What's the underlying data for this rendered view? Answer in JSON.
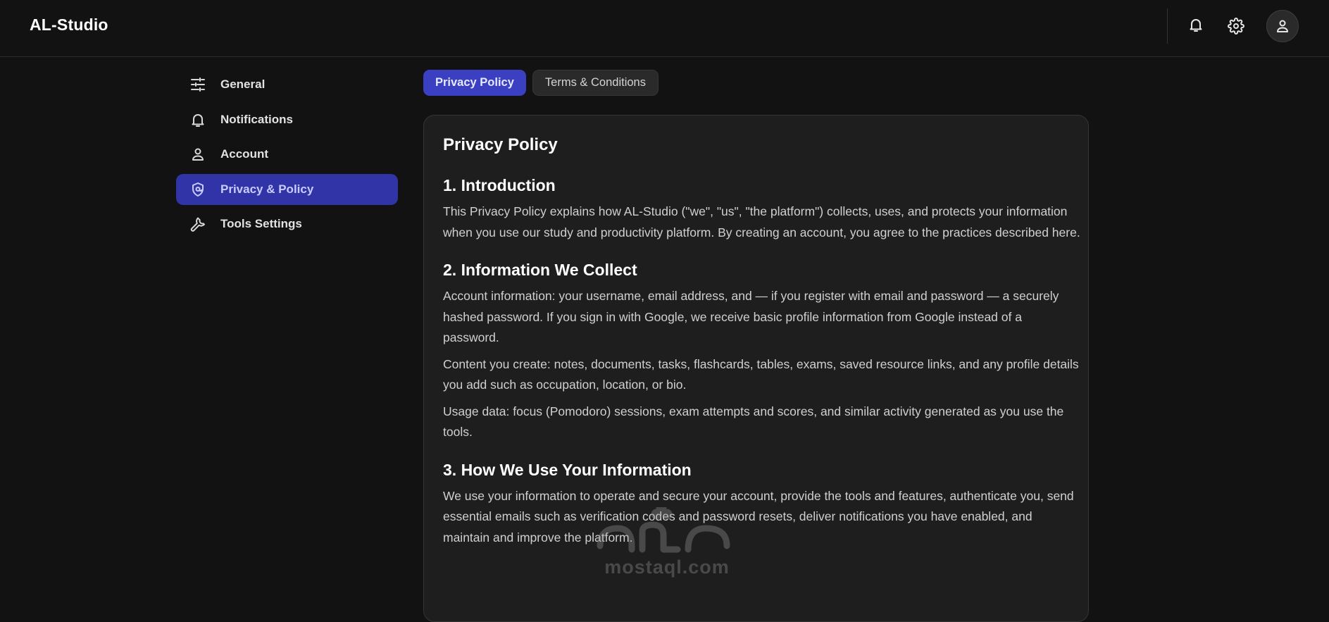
{
  "header": {
    "brand": "AL-Studio"
  },
  "sidebar": {
    "items": [
      {
        "label": "General",
        "icon": "sliders-icon",
        "active": false
      },
      {
        "label": "Notifications",
        "icon": "bell-icon",
        "active": false
      },
      {
        "label": "Account",
        "icon": "user-icon",
        "active": false
      },
      {
        "label": "Privacy & Policy",
        "icon": "shield-icon",
        "active": true
      },
      {
        "label": "Tools Settings",
        "icon": "wrench-icon",
        "active": false
      }
    ]
  },
  "tabs": [
    {
      "label": "Privacy Policy",
      "active": true
    },
    {
      "label": "Terms & Conditions",
      "active": false
    }
  ],
  "content": {
    "title": "Privacy Policy",
    "sections": [
      {
        "heading": "1. Introduction",
        "paragraphs": [
          "This Privacy Policy explains how AL-Studio (\"we\", \"us\", \"the platform\") collects, uses, and protects your information when you use our study and productivity platform. By creating an account, you agree to the practices described here."
        ]
      },
      {
        "heading": "2. Information We Collect",
        "paragraphs": [
          "Account information: your username, email address, and — if you register with email and password — a securely hashed password. If you sign in with Google, we receive basic profile information from Google instead of a password.",
          "Content you create: notes, documents, tasks, flashcards, tables, exams, saved resource links, and any profile details you add such as occupation, location, or bio.",
          "Usage data: focus (Pomodoro) sessions, exam attempts and scores, and similar activity generated as you use the tools."
        ]
      },
      {
        "heading": "3. How We Use Your Information",
        "paragraphs": [
          "We use your information to operate and secure your account, provide the tools and features, authenticate you, send essential emails such as verification codes and password resets, deliver notifications you have enabled, and maintain and improve the platform."
        ]
      }
    ]
  },
  "watermark": {
    "text": "mostaql.com"
  },
  "colors": {
    "background": "#121212",
    "card": "#1e1e1e",
    "accent": "#3b40c2",
    "sidebar_active": "#3034a6"
  }
}
